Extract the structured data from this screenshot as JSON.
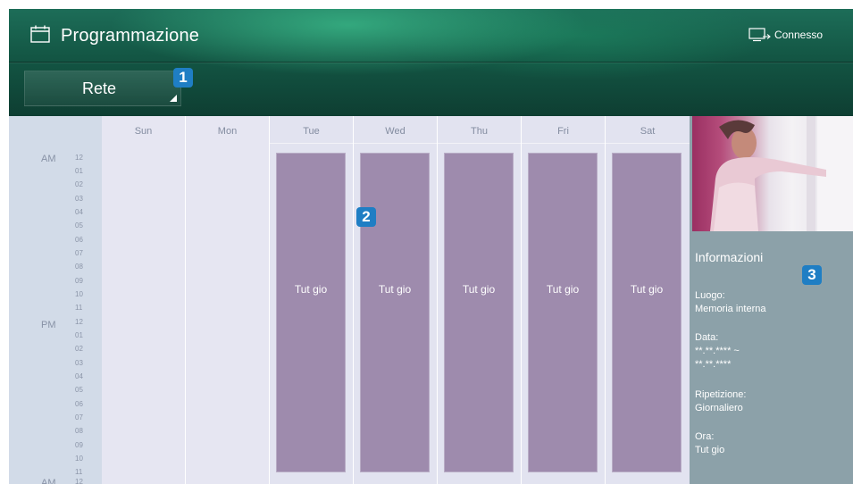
{
  "header": {
    "title": "Programmazione",
    "icon": "calendar-icon",
    "status_icon": "tv-link-icon",
    "status_label": "Connesso"
  },
  "source_dropdown": {
    "value": "Rete"
  },
  "badges": [
    "1",
    "2",
    "3"
  ],
  "schedule": {
    "days": [
      "Sun",
      "Mon",
      "Tue",
      "Wed",
      "Thu",
      "Fri",
      "Sat"
    ],
    "am_label": "AM",
    "pm_label": "PM",
    "am_end_label": "AM",
    "am_hours": [
      "12",
      "01",
      "02",
      "03",
      "04",
      "05",
      "06",
      "07",
      "08",
      "09",
      "10",
      "11"
    ],
    "pm_hours": [
      "12",
      "01",
      "02",
      "03",
      "04",
      "05",
      "06",
      "07",
      "08",
      "09",
      "10",
      "11"
    ],
    "end_hour": "12",
    "events": [
      {
        "day": "Tue",
        "label": "Tut gio"
      },
      {
        "day": "Wed",
        "label": "Tut gio"
      },
      {
        "day": "Thu",
        "label": "Tut gio"
      },
      {
        "day": "Fri",
        "label": "Tut gio"
      },
      {
        "day": "Sat",
        "label": "Tut gio"
      }
    ]
  },
  "info": {
    "title": "Informazioni",
    "luogo_label": "Luogo:",
    "luogo_value": "Memoria interna",
    "data_label": "Data:",
    "data_value_1": "**.**.**** ~",
    "data_value_2": "**.**.****",
    "ripetizione_label": "Ripetizione:",
    "ripetizione_value": "Giornaliero",
    "ora_label": "Ora:",
    "ora_value": "Tut gio"
  },
  "colors": {
    "header_green": "#135644",
    "event_purple": "#9e8bad",
    "info_panel": "#8ca1a9",
    "badge_blue": "#1f7ec4"
  }
}
